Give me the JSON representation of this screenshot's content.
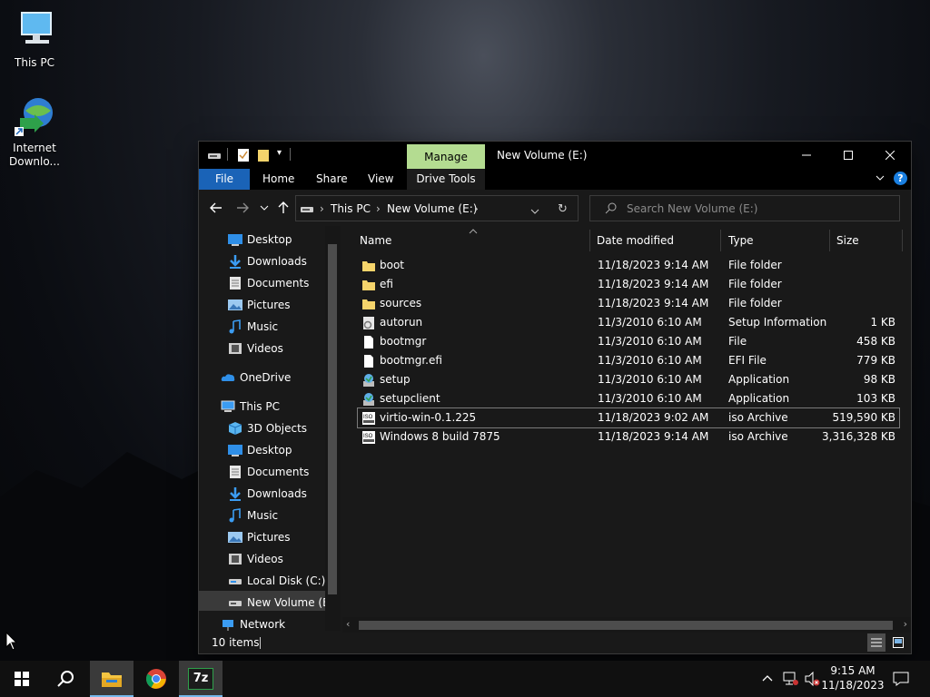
{
  "desktop": {
    "icons": [
      {
        "label": "This PC",
        "icon": "this-pc-icon"
      },
      {
        "label": "Internet Downlo...",
        "label_line1": "Internet",
        "label_line2": "Downlo...",
        "icon": "internet-download-manager-icon"
      }
    ]
  },
  "window": {
    "title": "New Volume (E:)",
    "contextual_tab_group": "Manage",
    "ribbon_tabs": [
      "File",
      "Home",
      "Share",
      "View",
      "Drive Tools"
    ],
    "breadcrumb": [
      "This PC",
      "New Volume (E:)"
    ],
    "search_placeholder": "Search New Volume (E:)",
    "columns": {
      "name": "Name",
      "date": "Date modified",
      "type": "Type",
      "size": "Size"
    },
    "files": [
      {
        "name": "boot",
        "date": "11/18/2023 9:14 AM",
        "type": "File folder",
        "size": "",
        "icon": "folder-icon"
      },
      {
        "name": "efi",
        "date": "11/18/2023 9:14 AM",
        "type": "File folder",
        "size": "",
        "icon": "folder-icon"
      },
      {
        "name": "sources",
        "date": "11/18/2023 9:14 AM",
        "type": "File folder",
        "size": "",
        "icon": "folder-icon"
      },
      {
        "name": "autorun",
        "date": "11/3/2010 6:10 AM",
        "type": "Setup Information",
        "size": "1 KB",
        "icon": "setup-info-icon"
      },
      {
        "name": "bootmgr",
        "date": "11/3/2010 6:10 AM",
        "type": "File",
        "size": "458 KB",
        "icon": "file-icon"
      },
      {
        "name": "bootmgr.efi",
        "date": "11/3/2010 6:10 AM",
        "type": "EFI File",
        "size": "779 KB",
        "icon": "file-icon"
      },
      {
        "name": "setup",
        "date": "11/3/2010 6:10 AM",
        "type": "Application",
        "size": "98 KB",
        "icon": "application-icon"
      },
      {
        "name": "setupclient",
        "date": "11/3/2010 6:10 AM",
        "type": "Application",
        "size": "103 KB",
        "icon": "application-icon"
      },
      {
        "name": "virtio-win-0.1.225",
        "date": "11/18/2023 9:02 AM",
        "type": "iso Archive",
        "size": "519,590 KB",
        "icon": "iso-archive-icon"
      },
      {
        "name": "Windows 8 build 7875",
        "date": "11/18/2023 9:14 AM",
        "type": "iso Archive",
        "size": "3,316,328 KB",
        "icon": "iso-archive-icon"
      }
    ],
    "nav": {
      "quick_access": [
        "Desktop",
        "Downloads",
        "Documents",
        "Pictures",
        "Music",
        "Videos"
      ],
      "onedrive": "OneDrive",
      "this_pc": "This PC",
      "this_pc_items": [
        "3D Objects",
        "Desktop",
        "Documents",
        "Downloads",
        "Music",
        "Pictures",
        "Videos",
        "Local Disk (C:)",
        "New Volume (E:)"
      ],
      "network": "Network"
    },
    "status": "10 items"
  },
  "taskbar": {
    "time": "9:15 AM",
    "date": "11/18/2023",
    "apps": [
      "start-icon",
      "search-icon",
      "file-explorer-icon",
      "chrome-icon",
      "7zip-icon"
    ],
    "seven_zip_label": "7z"
  },
  "colors": {
    "accent": "#1a63b7",
    "manage_tab": "#b4dc91",
    "window_bg": "#191919"
  }
}
